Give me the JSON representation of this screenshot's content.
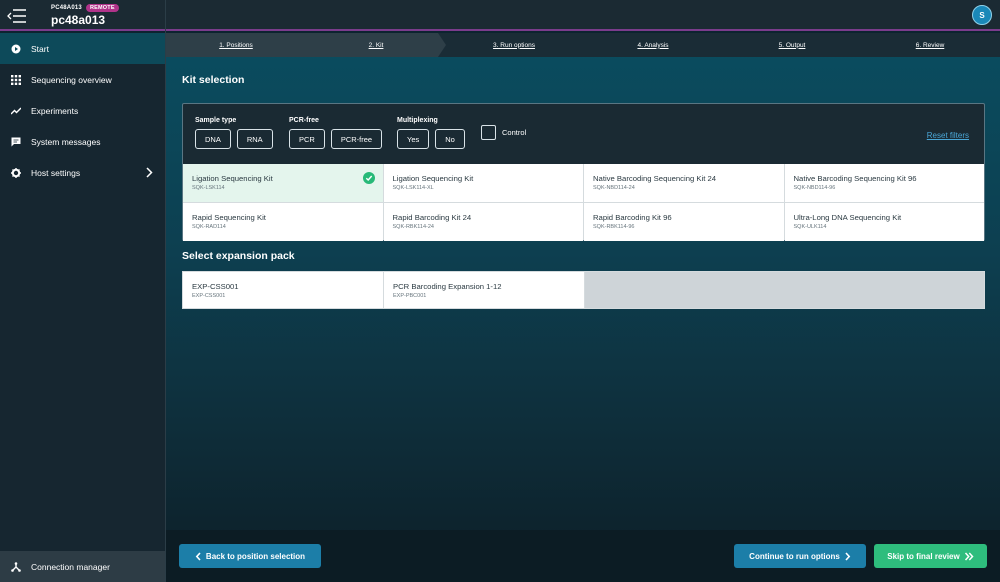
{
  "header": {
    "host_small": "PC48A013",
    "remote_badge": "REMOTE",
    "host_name": "pc48a013",
    "avatar_initial": "S"
  },
  "sidebar": {
    "items": [
      {
        "label": "Start",
        "icon": "play-circle-icon"
      },
      {
        "label": "Sequencing overview",
        "icon": "grid-icon"
      },
      {
        "label": "Experiments",
        "icon": "trend-icon"
      },
      {
        "label": "System messages",
        "icon": "message-icon"
      },
      {
        "label": "Host settings",
        "icon": "gear-icon"
      }
    ],
    "connection_manager": "Connection manager"
  },
  "steps": [
    "1. Positions",
    "2. Kit",
    "3. Run options",
    "4. Analysis",
    "5. Output",
    "6. Review"
  ],
  "kit_selection": {
    "title": "Kit selection",
    "filters": {
      "sample_type": {
        "label": "Sample type",
        "options": [
          "DNA",
          "RNA"
        ]
      },
      "pcr_free": {
        "label": "PCR-free",
        "options": [
          "PCR",
          "PCR-free"
        ]
      },
      "multiplexing": {
        "label": "Multiplexing",
        "options": [
          "Yes",
          "No"
        ]
      },
      "control_label": "Control",
      "reset_label": "Reset filters"
    },
    "kits": [
      {
        "name": "Ligation Sequencing Kit",
        "code": "SQK-LSK114",
        "selected": true
      },
      {
        "name": "Ligation Sequencing Kit",
        "code": "SQK-LSK114-XL",
        "selected": false
      },
      {
        "name": "Native Barcoding Sequencing Kit 24",
        "code": "SQK-NBD114-24",
        "selected": false
      },
      {
        "name": "Native Barcoding Sequencing Kit 96",
        "code": "SQK-NBD114-96",
        "selected": false
      },
      {
        "name": "Rapid Sequencing Kit",
        "code": "SQK-RAD114",
        "selected": false
      },
      {
        "name": "Rapid Barcoding Kit 24",
        "code": "SQK-RBK114-24",
        "selected": false
      },
      {
        "name": "Rapid Barcoding Kit 96",
        "code": "SQK-RBK114-96",
        "selected": false
      },
      {
        "name": "Ultra-Long DNA Sequencing Kit",
        "code": "SQK-ULK114",
        "selected": false
      }
    ]
  },
  "expansion": {
    "title": "Select expansion pack",
    "packs": [
      {
        "name": "EXP-CSS001",
        "code": "EXP-CSS001"
      },
      {
        "name": "PCR Barcoding Expansion 1-12",
        "code": "EXP-PBC001"
      }
    ]
  },
  "footer": {
    "back_label": "Back to position selection",
    "continue_label": "Continue to run options",
    "skip_label": "Skip to final review"
  },
  "colors": {
    "accent": "#1c7ea8",
    "success": "#2ebd7d",
    "remote_badge": "#b0338a"
  }
}
